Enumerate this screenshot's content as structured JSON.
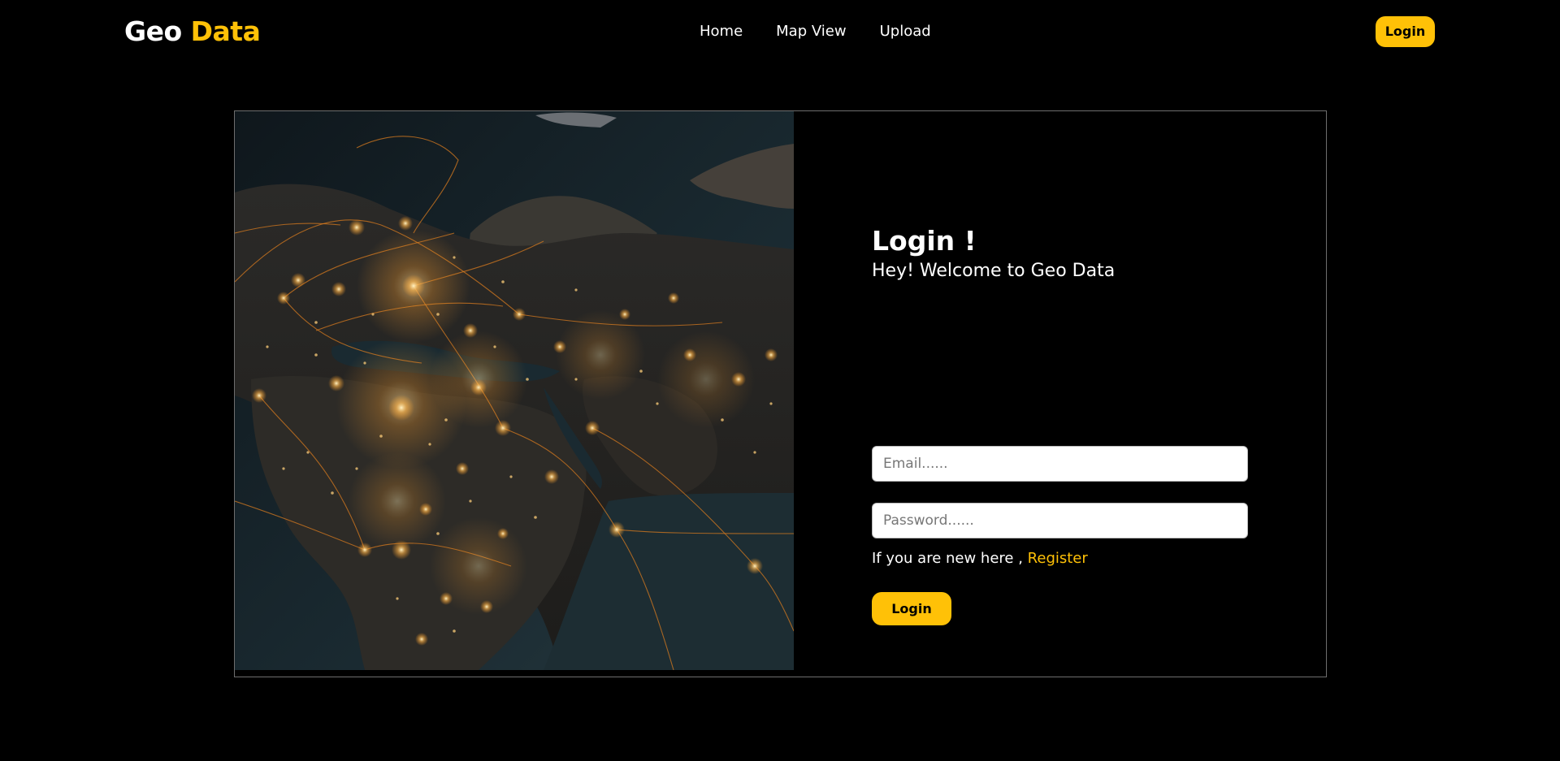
{
  "header": {
    "brand_part1": "Geo",
    "brand_part2": "Data",
    "nav": {
      "home": "Home",
      "map_view": "Map View",
      "upload": "Upload"
    },
    "login_label": "Login"
  },
  "login_card": {
    "title": "Login !",
    "subtitle": "Hey! Welcome to Geo Data",
    "email_placeholder": "Email......",
    "password_placeholder": "Password......",
    "register_prompt": "If you are new here ,",
    "register_link": "Register",
    "login_button": "Login"
  },
  "colors": {
    "accent": "#ffc107",
    "background": "#000000",
    "text": "#ffffff"
  },
  "image": {
    "description_icon": "night-earth-lights-image"
  }
}
